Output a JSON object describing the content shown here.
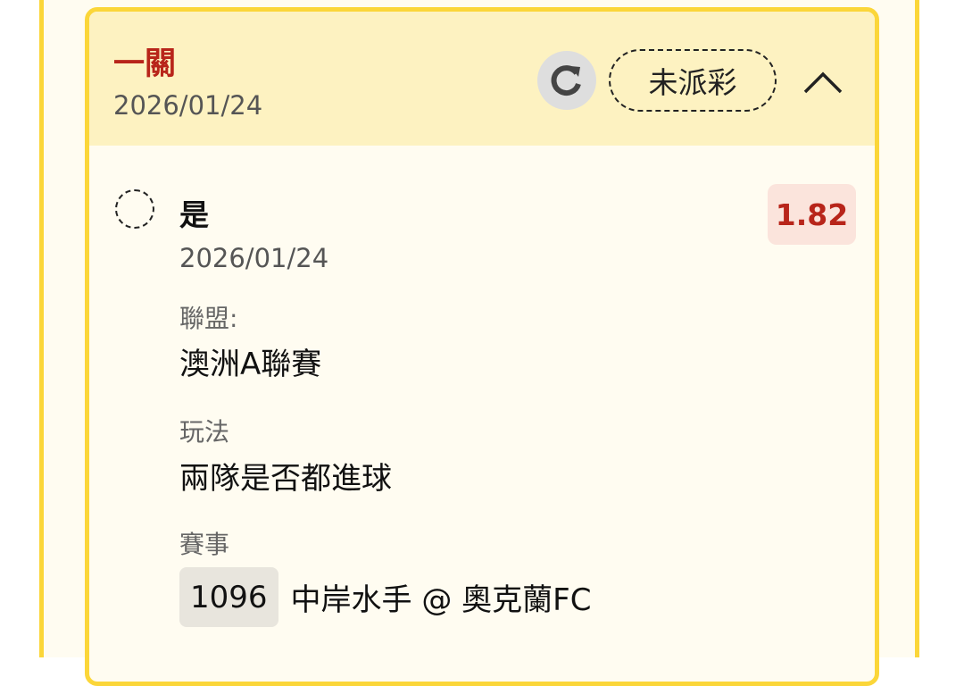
{
  "leg": {
    "title": "一關",
    "date": "2026/01/24",
    "status": "未派彩",
    "icons": [
      "refresh-icon",
      "chevron-up-icon"
    ]
  },
  "selection": {
    "name": "是",
    "date": "2026/01/24",
    "odds": "1.82",
    "result_icon": "pending-circle-icon"
  },
  "fields": {
    "league_label": "聯盟:",
    "league_value": "澳洲A聯賽",
    "bet_type_label": "玩法",
    "bet_type_value": "兩隊是否都進球",
    "match_label": "賽事",
    "match_number": "1096",
    "match_name": "中岸水手 @ 奧克蘭FC"
  },
  "colors": {
    "border": "#fbd639",
    "header_bg": "#fdf2c1",
    "accent_red": "#b8251a",
    "odds_bg": "#fbe4dc"
  }
}
